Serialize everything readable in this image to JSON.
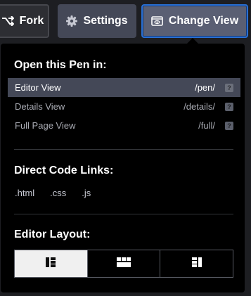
{
  "header": {
    "fork_label": "Fork",
    "settings_label": "Settings",
    "change_view_label": "Change View"
  },
  "dropdown": {
    "open_in": {
      "title": "Open this Pen in:",
      "options": [
        {
          "label": "Editor View",
          "path": "/pen/",
          "help": "?",
          "active": true
        },
        {
          "label": "Details View",
          "path": "/details/",
          "help": "?",
          "active": false
        },
        {
          "label": "Full Page View",
          "path": "/full/",
          "help": "?",
          "active": false
        }
      ]
    },
    "code_links": {
      "title": "Direct Code Links:",
      "links": [
        ".html",
        ".css",
        ".js"
      ]
    },
    "layout": {
      "title": "Editor Layout:",
      "options": [
        {
          "icon": "layout-left-icon",
          "selected": true
        },
        {
          "icon": "layout-top-icon",
          "selected": false
        },
        {
          "icon": "layout-right-icon",
          "selected": false
        }
      ]
    }
  },
  "colors": {
    "background": "#1d1e22",
    "panel": "#000000",
    "active_row": "#444857",
    "focus_border": "#2a6fd1"
  }
}
